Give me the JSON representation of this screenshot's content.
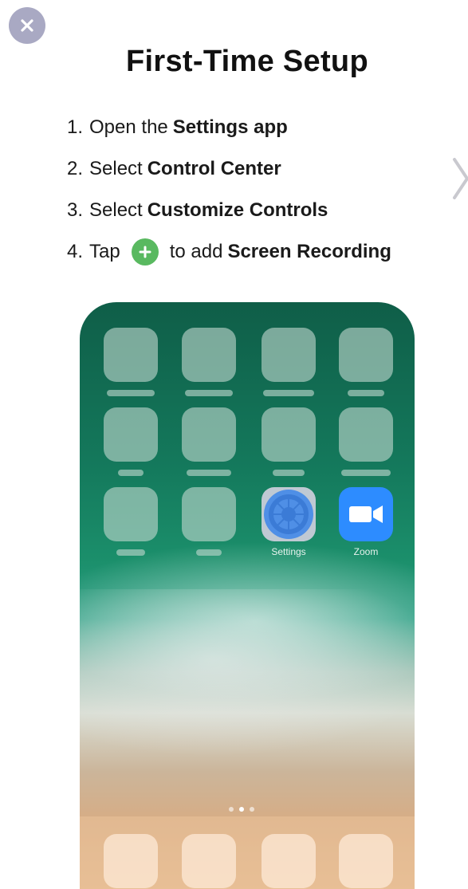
{
  "title": "First-Time Setup",
  "steps": [
    {
      "num": "1.",
      "pre": "Open the",
      "bold": "Settings app",
      "post": ""
    },
    {
      "num": "2.",
      "pre": "Select",
      "bold": "Control Center",
      "post": ""
    },
    {
      "num": "3.",
      "pre": "Select",
      "bold": "Customize Controls",
      "post": ""
    },
    {
      "num": "4.",
      "pre": "Tap",
      "bold": "Screen Recording",
      "post": "to add"
    }
  ],
  "apps": {
    "settings_label": "Settings",
    "zoom_label": "Zoom"
  },
  "page_indicator": {
    "count": 3,
    "active": 2
  },
  "colors": {
    "close_button": "#a9a9c3",
    "plus_icon": "#59b960",
    "zoom_app": "#2d8cff"
  },
  "icons": {
    "close": "close-icon",
    "next": "chevron-right-icon",
    "plus": "plus-circle-icon",
    "settings": "gear-icon",
    "zoom": "video-camera-icon"
  }
}
